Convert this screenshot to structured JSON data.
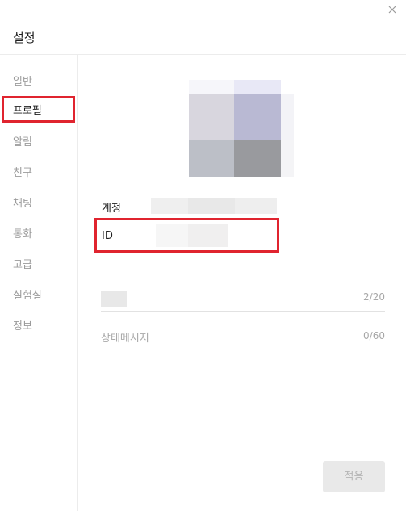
{
  "window": {
    "title": "설정",
    "close_icon": "close-icon"
  },
  "sidebar": {
    "items": [
      {
        "label": "일반",
        "active": false
      },
      {
        "label": "프로필",
        "active": true
      },
      {
        "label": "알림",
        "active": false
      },
      {
        "label": "친구",
        "active": false
      },
      {
        "label": "채팅",
        "active": false
      },
      {
        "label": "통화",
        "active": false
      },
      {
        "label": "고급",
        "active": false
      },
      {
        "label": "실험실",
        "active": false
      },
      {
        "label": "정보",
        "active": false
      }
    ]
  },
  "profile": {
    "account_label": "계정",
    "id_label": "ID",
    "name_counter": "2/20",
    "status_placeholder": "상태메시지",
    "status_counter": "0/60",
    "apply_label": "적용"
  },
  "colors": {
    "highlight": "#e0242f",
    "active_text": "#1e1e1e",
    "inactive_text": "#9b9b9b"
  }
}
